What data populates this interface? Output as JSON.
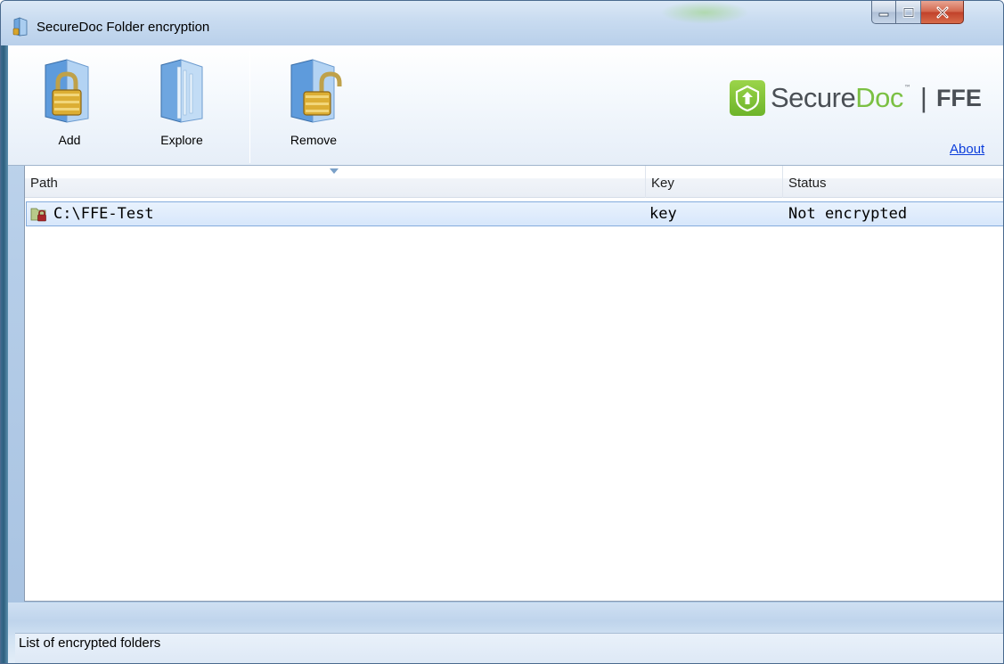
{
  "window": {
    "title": "SecureDoc Folder encryption"
  },
  "toolbar": {
    "add_label": "Add",
    "explore_label": "Explore",
    "remove_label": "Remove"
  },
  "logo": {
    "secure": "Secure",
    "doc": "Doc",
    "tm": "™",
    "separator": "|",
    "product": "FFE",
    "colors": {
      "green": "#7bc043",
      "gray": "#4a4f55"
    }
  },
  "about_label": "About",
  "list": {
    "columns": [
      "Path",
      "Key",
      "Status"
    ],
    "rows": [
      {
        "path": "C:\\FFE-Test",
        "key": "key",
        "status": "Not encrypted"
      }
    ]
  },
  "statusbar": {
    "text": "List of encrypted folders"
  }
}
